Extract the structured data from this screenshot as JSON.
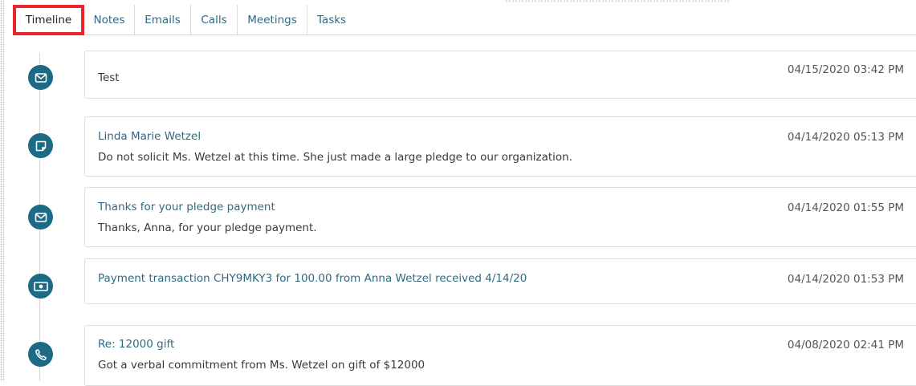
{
  "tabs": [
    {
      "label": "Timeline",
      "active": true
    },
    {
      "label": "Notes",
      "active": false
    },
    {
      "label": "Emails",
      "active": false
    },
    {
      "label": "Calls",
      "active": false
    },
    {
      "label": "Meetings",
      "active": false
    },
    {
      "label": "Tasks",
      "active": false
    }
  ],
  "colors": {
    "accent": "#1d6a86",
    "link": "#2f6a80",
    "highlight_box": "#e8262d"
  },
  "timeline": [
    {
      "icon": "envelope-icon",
      "title": "",
      "body": "Test",
      "date": "04/15/2020 03:42 PM"
    },
    {
      "icon": "note-icon",
      "title": "Linda Marie Wetzel",
      "body": "Do not solicit Ms. Wetzel at this time. She just made a large pledge to our organization.",
      "date": "04/14/2020 05:13 PM"
    },
    {
      "icon": "envelope-icon",
      "title": "Thanks for your pledge payment",
      "body": "Thanks, Anna, for your pledge payment.",
      "date": "04/14/2020 01:55 PM"
    },
    {
      "icon": "money-icon",
      "title": "Payment transaction CHY9MKY3 for 100.00 from Anna Wetzel received 4/14/20",
      "body": "",
      "date": "04/14/2020 01:53 PM"
    },
    {
      "icon": "phone-icon",
      "title": "Re: 12000 gift",
      "body": "Got a verbal commitment from Ms. Wetzel on gift of $12000",
      "date": "04/08/2020 02:41 PM"
    }
  ]
}
